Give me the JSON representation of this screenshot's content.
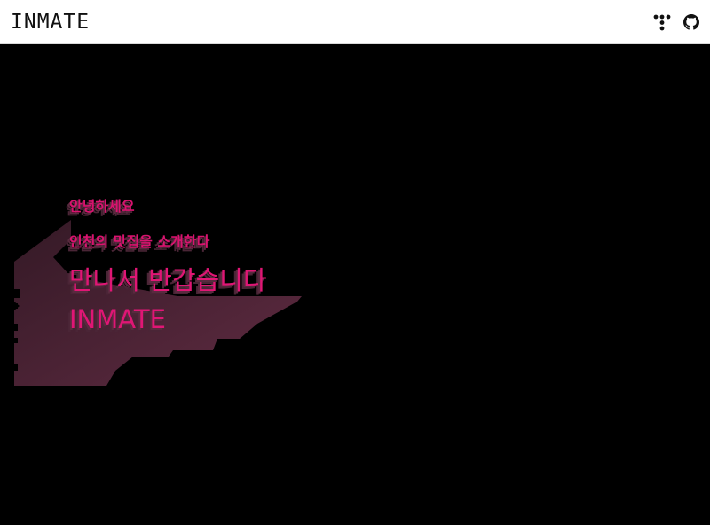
{
  "navbar": {
    "brand": "INMATE",
    "icons": [
      "tistory-icon",
      "github-icon"
    ]
  },
  "hero": {
    "line1": "안녕하세요",
    "line2": "인천의 맛집을 소개한다",
    "line3": "만나서 반갑습니다",
    "line4": "INMATE"
  },
  "colors": {
    "accent": "#e01675",
    "shadow": "#4a2536",
    "background": "#000000",
    "navbar": "#ffffff"
  }
}
